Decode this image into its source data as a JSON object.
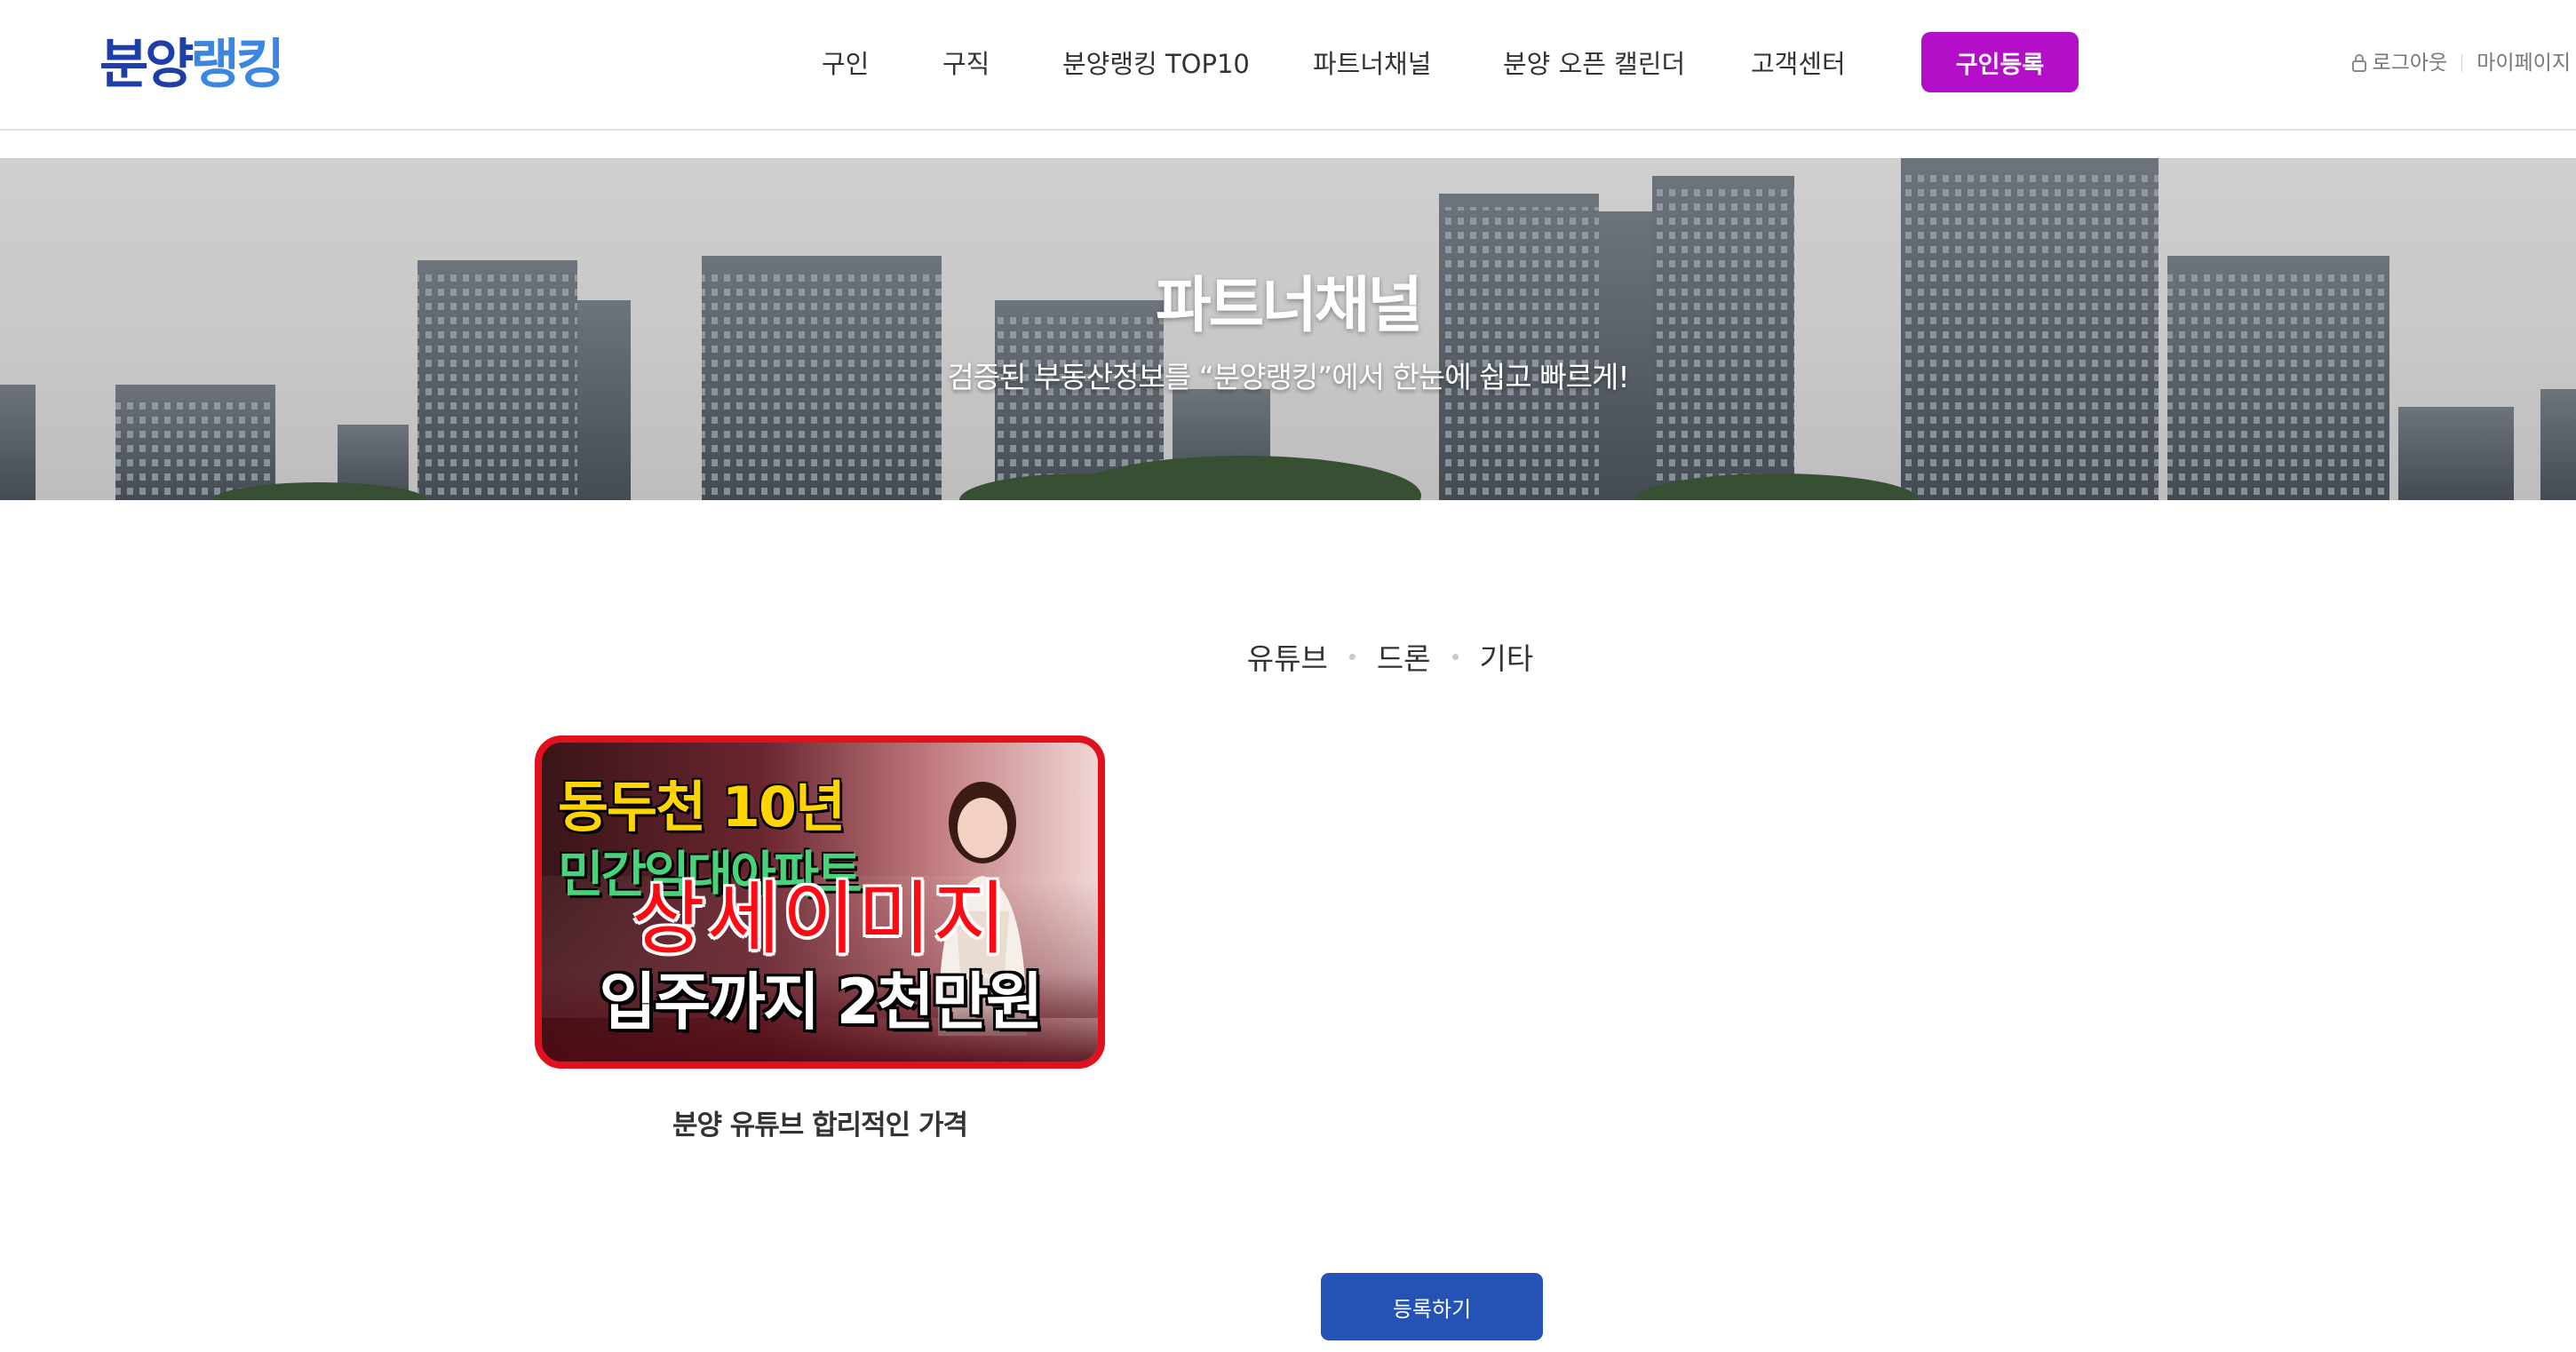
{
  "header": {
    "logo_part1": "분양",
    "logo_part2": "랭킹",
    "nav": [
      "구인",
      "구직",
      "분양랭킹 TOP10",
      "파트너채널",
      "분양 오픈 캘린더",
      "고객센터"
    ],
    "register_label": "구인등록",
    "logout_label": "로그아웃",
    "mypage_label": "마이페이지"
  },
  "banner": {
    "title": "파트너채널",
    "subtitle": "검증된 부동산정보를 “분양랭킹”에서 한눈에 쉽고 빠르게!"
  },
  "tabs": [
    "유튜브",
    "드론",
    "기타"
  ],
  "card": {
    "thumb_line1": "동두천 10년",
    "thumb_line2": "민간임대아파트",
    "thumb_overlay": "상세이미지",
    "thumb_line3": "입주까지 2천만원",
    "title": "분양 유튜브 합리적인 가격"
  },
  "submit_label": "등록하기",
  "colors": {
    "logo_dark": "#1f3fa8",
    "logo_light": "#3b86e0",
    "register": "#b30fc9",
    "submit": "#2452b5",
    "thumb_border": "#e0101c"
  },
  "icons": {
    "lock": "lock-icon"
  }
}
